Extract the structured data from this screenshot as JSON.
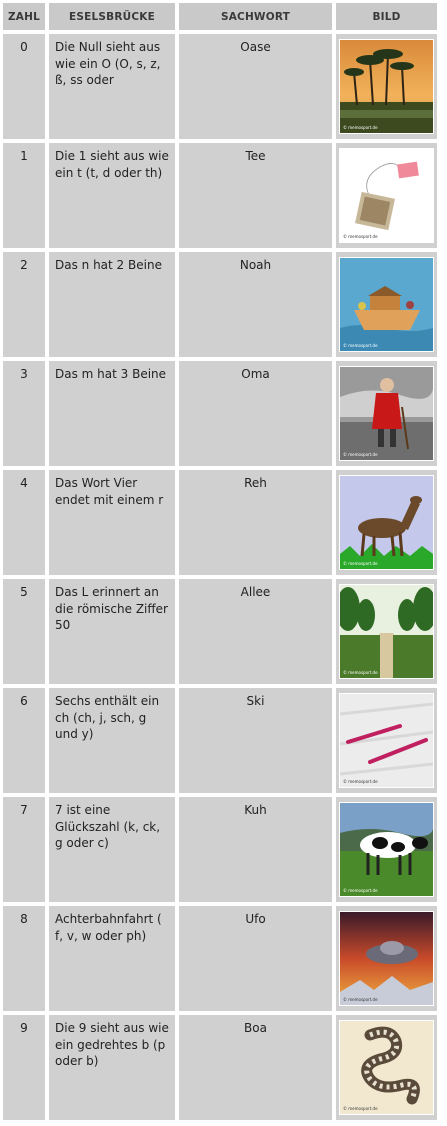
{
  "headers": {
    "number": "ZAHL",
    "mnemonic": "ESELSBRÜCKE",
    "word": "SACHWORT",
    "image": "BILD"
  },
  "credit": "© memosport.de",
  "rows": [
    {
      "number": "0",
      "mnemonic": "Die Null sieht aus wie ein O (O, s, z, ß, ss oder",
      "word": "Oase",
      "image": "oasis-palms-image"
    },
    {
      "number": "1",
      "mnemonic": "Die 1 sieht aus wie ein t (t, d oder th)",
      "word": "Tee",
      "image": "teabag-image"
    },
    {
      "number": "2",
      "mnemonic": "Das n hat 2 Beine",
      "word": "Noah",
      "image": "noahs-ark-image"
    },
    {
      "number": "3",
      "mnemonic": "Das m hat 3 Beine",
      "word": "Oma",
      "image": "grandma-walking-image"
    },
    {
      "number": "4",
      "mnemonic": "Das Wort Vier endet mit einem r",
      "word": "Reh",
      "image": "deer-image"
    },
    {
      "number": "5",
      "mnemonic": "Das L erinnert an die römische Ziffer 50",
      "word": "Allee",
      "image": "tree-avenue-image"
    },
    {
      "number": "6",
      "mnemonic": "Sechs enthält ein ch (ch, j, sch, g und y)",
      "word": "Ski",
      "image": "skis-image"
    },
    {
      "number": "7",
      "mnemonic": "7 ist eine Glückszahl (k, ck, g oder c)",
      "word": "Kuh",
      "image": "cow-image"
    },
    {
      "number": "8",
      "mnemonic": "Achterbahnfahrt ( f, v, w oder ph)",
      "word": "Ufo",
      "image": "ufo-image"
    },
    {
      "number": "9",
      "mnemonic": "Die 9 sieht aus wie ein gedrehtes b (p oder b)",
      "word": "Boa",
      "image": "boa-snake-image"
    }
  ]
}
